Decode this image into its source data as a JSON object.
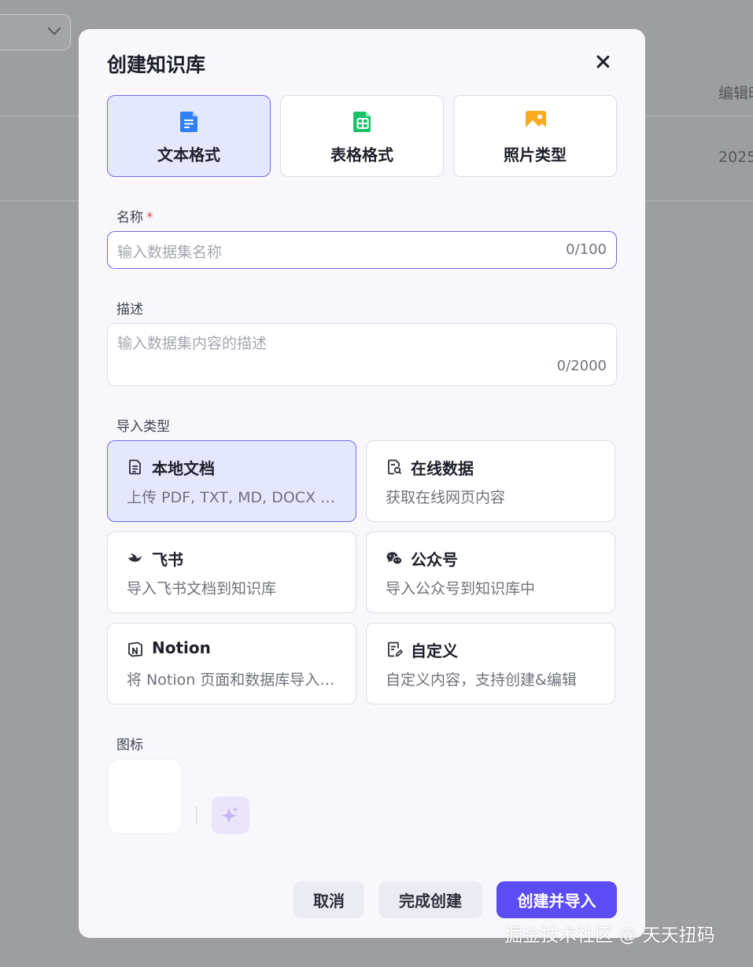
{
  "background": {
    "column_header": "编辑时",
    "row_date": "2025"
  },
  "modal": {
    "title": "创建知识库",
    "format_types": [
      {
        "label": "文本格式",
        "icon": "text-doc-icon",
        "active": true
      },
      {
        "label": "表格格式",
        "icon": "table-icon",
        "active": false
      },
      {
        "label": "照片类型",
        "icon": "image-icon",
        "active": false
      }
    ],
    "name_field": {
      "label": "名称",
      "required_mark": "*",
      "placeholder": "输入数据集名称",
      "value": "",
      "counter": "0/100"
    },
    "description_field": {
      "label": "描述",
      "placeholder": "输入数据集内容的描述",
      "value": "",
      "counter": "0/2000"
    },
    "import_section": {
      "label": "导入类型",
      "options": [
        {
          "title": "本地文档",
          "desc": "上传 PDF, TXT, MD, DOCX 等格式的本地文件",
          "icon": "document-icon",
          "active": true
        },
        {
          "title": "在线数据",
          "desc": "获取在线网页内容",
          "icon": "web-document-icon",
          "active": false
        },
        {
          "title": "飞书",
          "desc": "导入飞书文档到知识库",
          "icon": "feishu-icon",
          "active": false
        },
        {
          "title": "公众号",
          "desc": "导入公众号到知识库中",
          "icon": "wechat-icon",
          "active": false
        },
        {
          "title": "Notion",
          "desc": "将 Notion 页面和数据库导入知识库",
          "icon": "notion-icon",
          "active": false
        },
        {
          "title": "自定义",
          "desc": "自定义内容，支持创建&编辑",
          "icon": "edit-document-icon",
          "active": false
        }
      ]
    },
    "icon_section": {
      "label": "图标",
      "ai_button_icon": "sparkle-icon"
    },
    "buttons": {
      "cancel": "取消",
      "finish": "完成创建",
      "create_import": "创建并导入"
    }
  },
  "watermark": "掘金技术社区 @ 天天扭码",
  "colors": {
    "primary": "#5b4cf5",
    "active_bg": "#e5e7fd",
    "active_border": "#6f6cf0",
    "required": "#e5483d"
  }
}
